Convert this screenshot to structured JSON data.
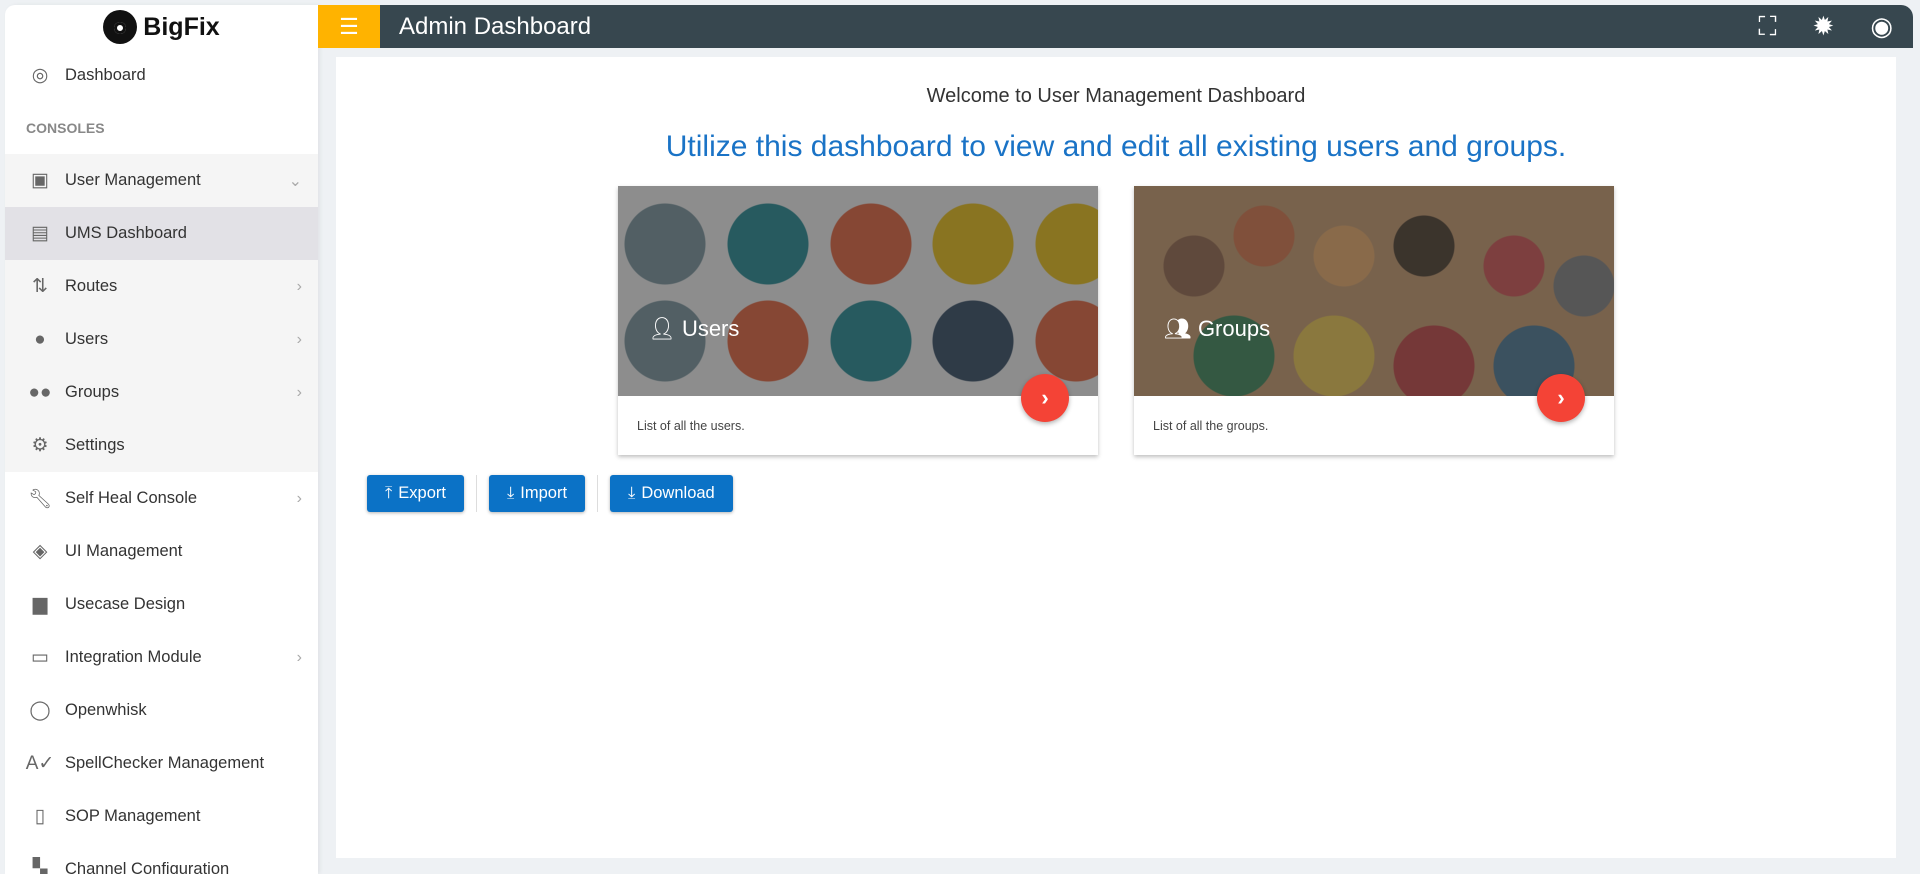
{
  "brand": {
    "name": "BigFix"
  },
  "header": {
    "title": "Admin Dashboard"
  },
  "sidebar": {
    "dashboard": "Dashboard",
    "section": "CONSOLES",
    "items": [
      {
        "label": "User Management",
        "icon": "account-box-icon",
        "chev": "⌄"
      },
      {
        "label": "UMS Dashboard",
        "icon": "badge-icon"
      },
      {
        "label": "Routes",
        "icon": "swap-vert-icon",
        "chev": "›"
      },
      {
        "label": "Users",
        "icon": "person-icon",
        "chev": "›"
      },
      {
        "label": "Groups",
        "icon": "people-icon",
        "chev": "›"
      },
      {
        "label": "Settings",
        "icon": "gear-icon"
      },
      {
        "label": "Self Heal Console",
        "icon": "wrench-icon",
        "chev": "›"
      },
      {
        "label": "UI Management",
        "icon": "paint-bucket-icon"
      },
      {
        "label": "Usecase Design",
        "icon": "message-icon"
      },
      {
        "label": "Integration Module",
        "icon": "web-icon",
        "chev": "›"
      },
      {
        "label": "Openwhisk",
        "icon": "cloud-icon"
      },
      {
        "label": "SpellChecker Management",
        "icon": "spellcheck-icon"
      },
      {
        "label": "SOP Management",
        "icon": "clipboard-icon"
      },
      {
        "label": "Channel Configuration",
        "icon": "widgets-icon"
      }
    ]
  },
  "main": {
    "welcome": "Welcome to User Management Dashboard",
    "subtitle": "Utilize this dashboard to view and edit all existing users and groups.",
    "cards": [
      {
        "title": "Users",
        "description": "List of all the users."
      },
      {
        "title": "Groups",
        "description": "List of all the groups."
      }
    ],
    "buttons": {
      "export": "Export",
      "import": "Import",
      "download": "Download"
    }
  },
  "colors": {
    "accent": "#ffb300",
    "topbar": "#37474f",
    "primary": "#0b72c6",
    "fab": "#f44336"
  }
}
